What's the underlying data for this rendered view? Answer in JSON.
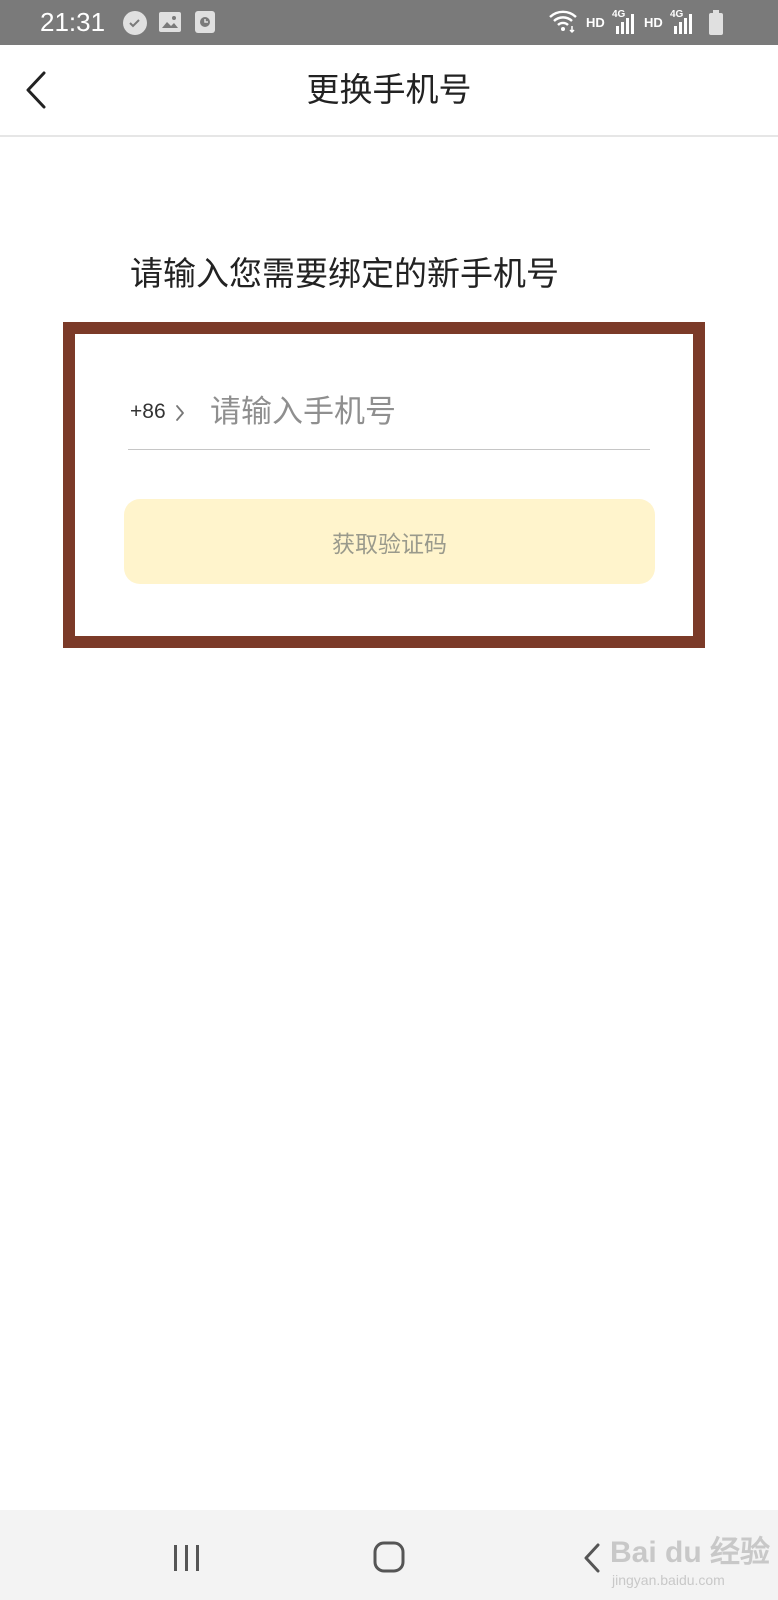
{
  "status_bar": {
    "time": "21:31",
    "left_icons": [
      "messenger-icon",
      "gallery-icon",
      "recorder-icon"
    ],
    "hd_label_1": "HD",
    "network_label_1": "4G",
    "hd_label_2": "HD",
    "network_label_2": "4G"
  },
  "header": {
    "title": "更换手机号"
  },
  "form": {
    "instruction": "请输入您需要绑定的新手机号",
    "country_code": "+86",
    "phone_placeholder": "请输入手机号",
    "phone_value": "",
    "get_code_label": "获取验证码"
  },
  "watermark": {
    "brand": "Bai du 经验",
    "url": "jingyan.baidu.com"
  },
  "colors": {
    "highlight_border": "#7b3a28",
    "button_bg": "#fff4cc",
    "button_text": "#9a9a8c",
    "status_bar_bg": "#7a7a7a"
  }
}
